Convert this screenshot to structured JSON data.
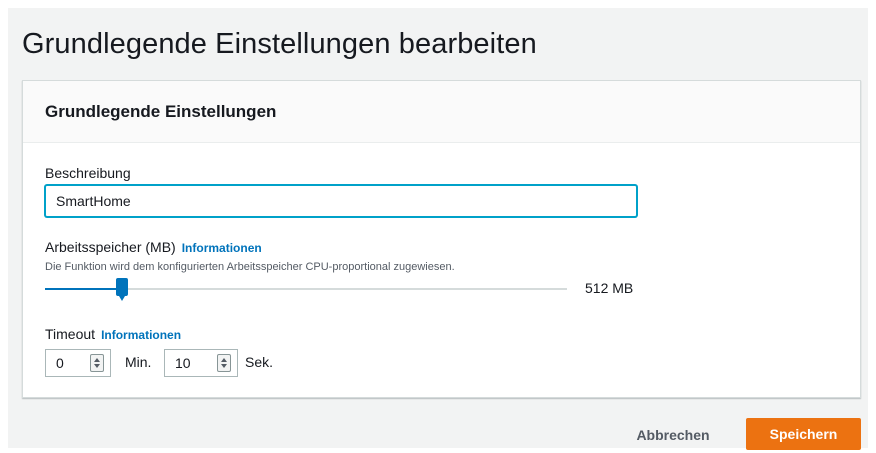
{
  "page": {
    "title": "Grundlegende Einstellungen bearbeiten"
  },
  "panel": {
    "title": "Grundlegende Einstellungen"
  },
  "description": {
    "label": "Beschreibung",
    "value": "SmartHome"
  },
  "memory": {
    "label": "Arbeitsspeicher (MB)",
    "info_link": "Informationen",
    "help_text": "Die Funktion wird dem konfigurierten Arbeitsspeicher CPU-proportional zugewiesen.",
    "value_text": "512 MB",
    "slider_fraction": 0.148
  },
  "timeout": {
    "label": "Timeout",
    "info_link": "Informationen",
    "minutes_value": "0",
    "minutes_unit": "Min.",
    "seconds_value": "10",
    "seconds_unit": "Sek."
  },
  "actions": {
    "cancel_label": "Abbrechen",
    "save_label": "Speichern"
  },
  "icons": {
    "spinner": "spinner-arrows-icon"
  },
  "colors": {
    "accent": "#0073bb",
    "primary_button": "#ec7211",
    "focus": "#00a1c9"
  }
}
